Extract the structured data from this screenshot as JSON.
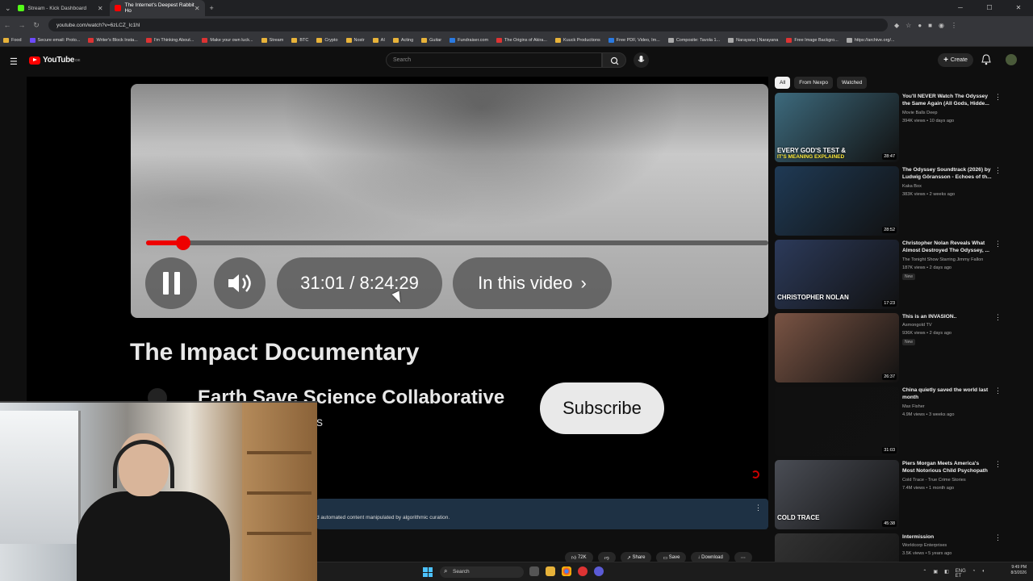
{
  "browser": {
    "tabs": [
      {
        "title": "Stream - Kick Dashboard",
        "color": "#53fc18"
      },
      {
        "title": "The Internet's Deepest Rabbit Ho",
        "color": "#ff0000"
      }
    ],
    "url": "youtube.com/watch?v=6zLCZ_Ic1hI",
    "bookmarks": [
      "Food",
      "Secure email: Proto...",
      "Writer's Block Insta...",
      "I'm Thinking About...",
      "Make your own luck...",
      "Stream",
      "BTC",
      "Crypto",
      "Nostr",
      "AI",
      "Acting",
      "Guitar",
      "Fundraiser.com",
      "The Origins of Akira...",
      "Kuuck Productions",
      "Free PDF, Video, Im...",
      "Composite: Tavola 1...",
      "Narayana | Narayana",
      "Free Image Backgro...",
      "https://archive.org/..."
    ]
  },
  "youtube": {
    "logo_text": "YouTube",
    "logo_sup": "DE",
    "search_placeholder": "Search",
    "create_label": "Create",
    "player": {
      "progress_fraction": 0.06,
      "time_display": "31:01 / 8:24:29",
      "chapter_label": "In this video",
      "video_title": "The Impact Documentary",
      "channel_name": "Earth Save Science Collaborative",
      "partial_text": "s",
      "subscribe_label": "Subscribe"
    },
    "info_text": "d automated content manipulated by algorithmic curation.",
    "actions": {
      "likes": "72K",
      "share": "Share",
      "save": "Save",
      "download": "Download"
    },
    "chips": [
      "All",
      "From Nexpo",
      "Watched"
    ],
    "recommendations": [
      {
        "title": "You'll NEVER Watch The Odyssey the Same Again (All Gods, Hidde...",
        "channel": "Movie Balls Deep",
        "meta": "394K views • 10 days ago",
        "duration": "28:47",
        "caption1": "EVERY GOD'S TEST &",
        "caption2": "IT'S MEANING EXPLAINED",
        "bg": "#3d6a7d"
      },
      {
        "title": "The Odyssey Soundtrack (2026) by Ludwig Göransson - Echoes of th...",
        "channel": "Kaka Box",
        "meta": "383K views • 2 weeks ago",
        "duration": "28:52",
        "bg": "#1f3a55"
      },
      {
        "title": "Christopher Nolan Reveals What Almost Destroyed The Odyssey, ...",
        "channel": "The Tonight Show Starring Jimmy Fallon",
        "meta": "187K views • 2 days ago",
        "badge": "New",
        "duration": "17:23",
        "caption1": "CHRISTOPHER NOLAN",
        "bg": "#2c3a5a"
      },
      {
        "title": "This is an INVASION..",
        "channel": "Asmongold TV",
        "meta": "936K views • 2 days ago",
        "badge": "New",
        "duration": "26:37",
        "bg": "#7a5444"
      },
      {
        "title": "China quietly saved the world last month",
        "channel": "Max Fisher",
        "meta": "4.9M views • 3 weeks ago",
        "duration": "31:03",
        "bg": "#101010"
      },
      {
        "title": "Piers Morgan Meets America's Most Notorious Child Psychopath",
        "channel": "Cold Trace - True Crime Stories",
        "meta": "7.4M views • 1 month ago",
        "duration": "45:38",
        "caption1": "COLD TRACE",
        "bg": "#4a4d55"
      },
      {
        "title": "Intermission",
        "channel": "Worldcorp Enterprises",
        "meta": "3.5K views • 5 years ago",
        "bg": "#333"
      }
    ]
  },
  "taskbar": {
    "search_placeholder": "Search",
    "tray_lang": "ENG",
    "tray_region": "ET",
    "time": "9:49 PM",
    "date": "8/3/2026"
  }
}
